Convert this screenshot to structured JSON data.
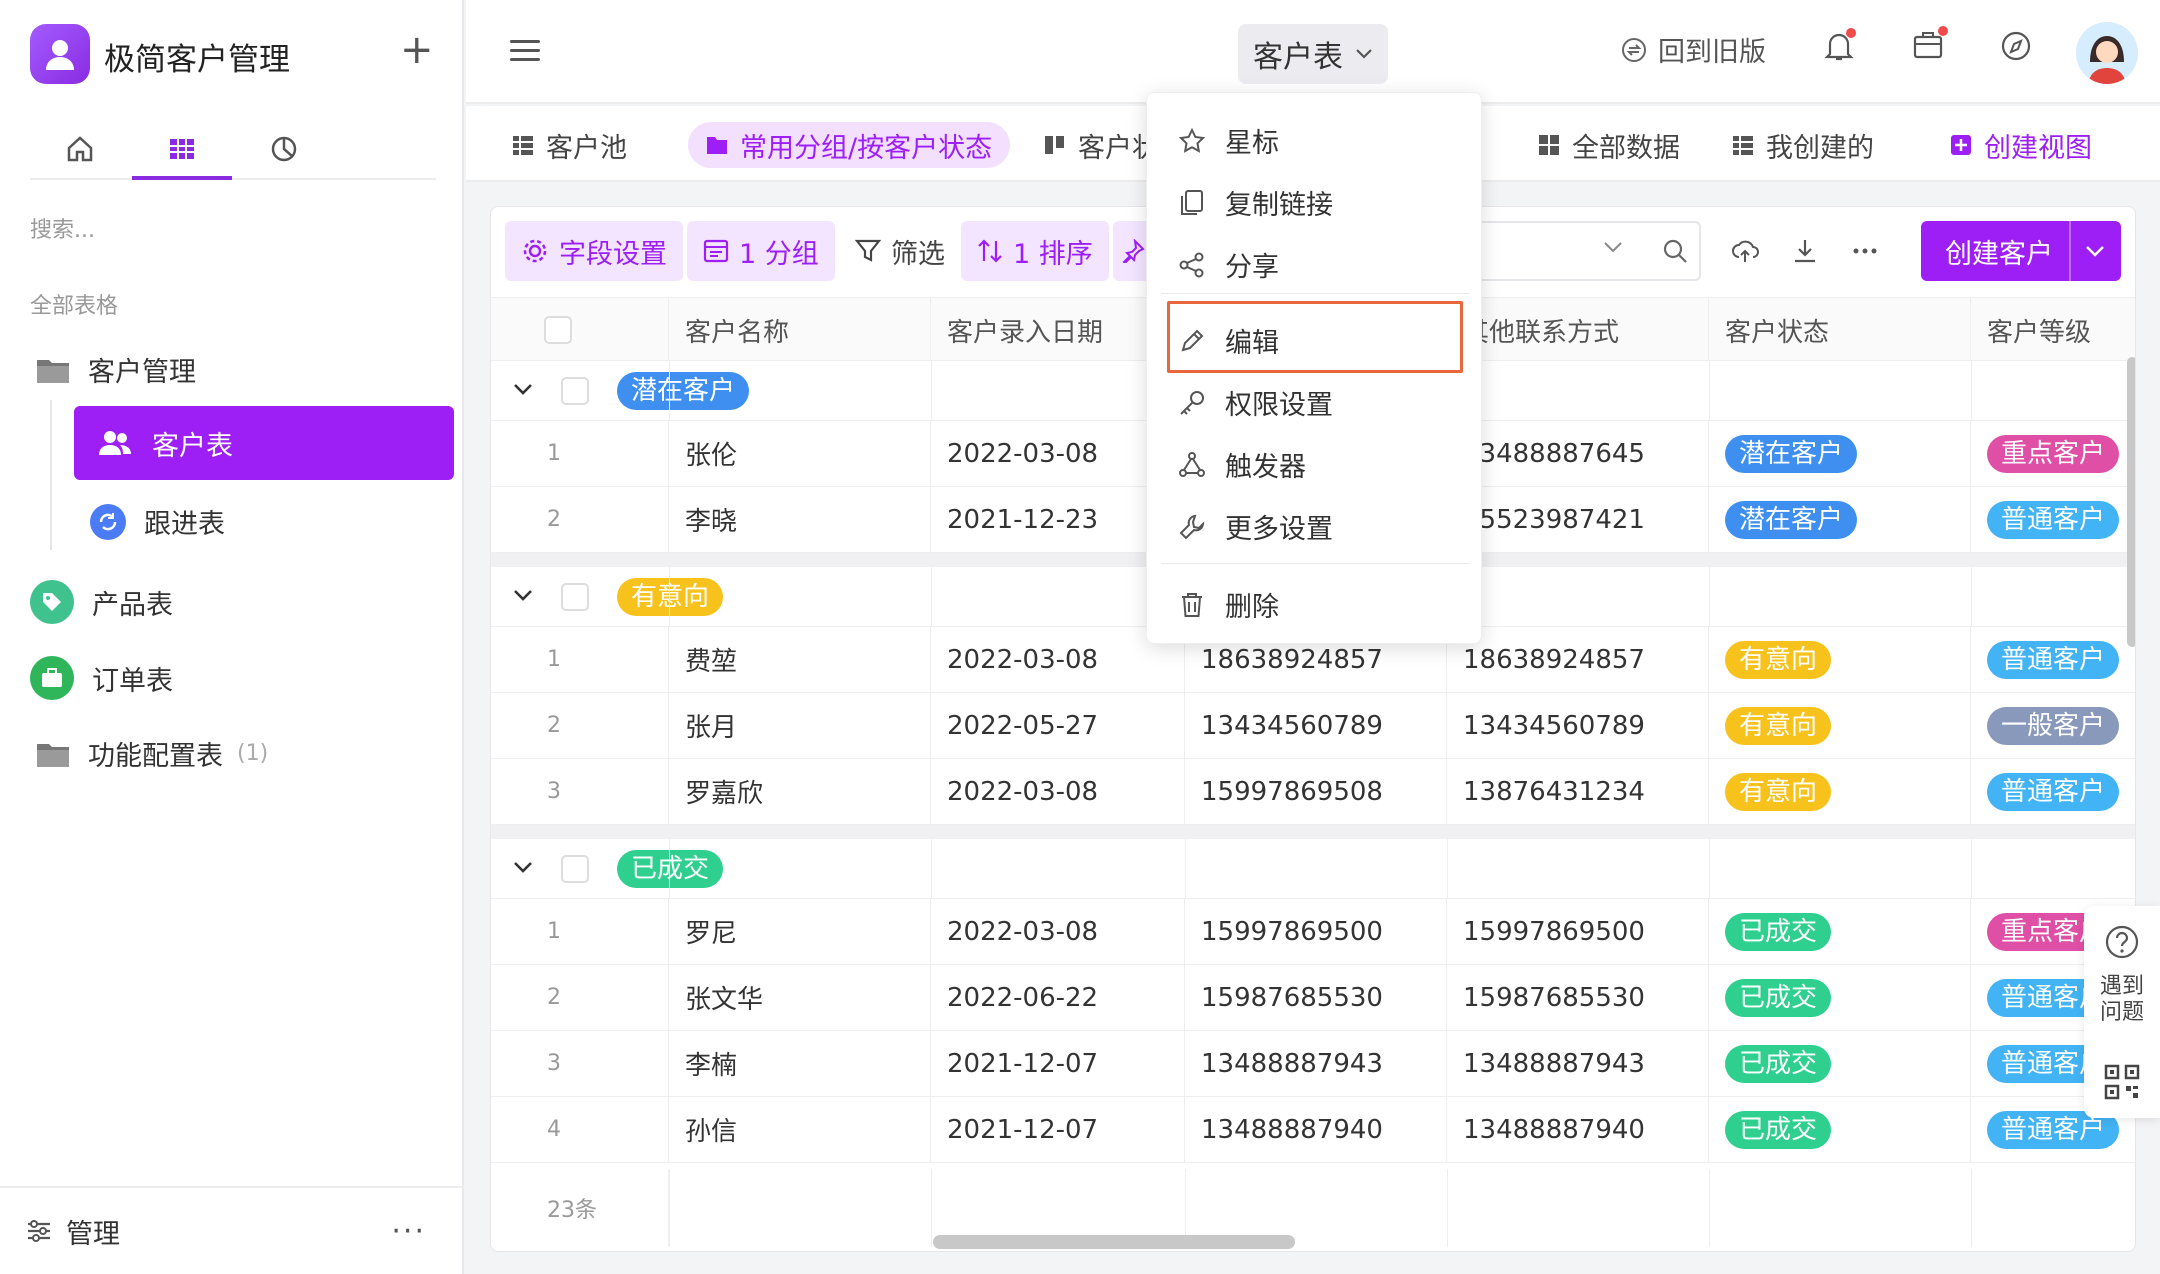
{
  "sidebar": {
    "app_title": "极简客户管理",
    "search_placeholder": "搜索...",
    "section_label": "全部表格",
    "items": [
      {
        "label": "客户管理"
      },
      {
        "label": "客户表"
      },
      {
        "label": "跟进表"
      },
      {
        "label": "产品表"
      },
      {
        "label": "订单表"
      },
      {
        "label": "功能配置表",
        "count": "(1)"
      }
    ],
    "footer_label": "管理",
    "footer_more": "···"
  },
  "header": {
    "title": "客户表",
    "back_old": "回到旧版"
  },
  "views": {
    "items": [
      {
        "label": "客户池"
      },
      {
        "label": "常用分组/按客户状态"
      },
      {
        "label": "客户状"
      },
      {
        "label": "全部数据"
      },
      {
        "label": "我创建的"
      },
      {
        "label": "创建视图"
      }
    ]
  },
  "toolbar": {
    "field_settings": "字段设置",
    "group": "1 分组",
    "filter": "筛选",
    "sort": "1 排序",
    "create_customer": "创建客户"
  },
  "table": {
    "headers": [
      "客户名称",
      "客户录入日期",
      "",
      "其他联系方式",
      "客户状态",
      "客户等级"
    ],
    "groups": [
      {
        "name": "潜在客户",
        "rows": [
          {
            "n": "1",
            "name": "张伦",
            "date": "2022-03-08",
            "phone": "",
            "other": "13488887645",
            "status": "潜在客户",
            "level": "重点客户"
          },
          {
            "n": "2",
            "name": "李晓",
            "date": "2021-12-23",
            "phone": "",
            "other": "15523987421",
            "status": "潜在客户",
            "level": "普通客户"
          }
        ]
      },
      {
        "name": "有意向",
        "rows": [
          {
            "n": "1",
            "name": "费堃",
            "date": "2022-03-08",
            "phone": "18638924857",
            "other": "18638924857",
            "status": "有意向",
            "level": "普通客户"
          },
          {
            "n": "2",
            "name": "张月",
            "date": "2022-05-27",
            "phone": "13434560789",
            "other": "13434560789",
            "status": "有意向",
            "level": "一般客户"
          },
          {
            "n": "3",
            "name": "罗嘉欣",
            "date": "2022-03-08",
            "phone": "15997869508",
            "other": "13876431234",
            "status": "有意向",
            "level": "普通客户"
          }
        ]
      },
      {
        "name": "已成交",
        "rows": [
          {
            "n": "1",
            "name": "罗尼",
            "date": "2022-03-08",
            "phone": "15997869500",
            "other": "15997869500",
            "status": "已成交",
            "level": "重点客户"
          },
          {
            "n": "2",
            "name": "张文华",
            "date": "2022-06-22",
            "phone": "15987685530",
            "other": "15987685530",
            "status": "已成交",
            "level": "普通客户"
          },
          {
            "n": "3",
            "name": "李楠",
            "date": "2021-12-07",
            "phone": "13488887943",
            "other": "13488887943",
            "status": "已成交",
            "level": "普通客户"
          },
          {
            "n": "4",
            "name": "孙信",
            "date": "2021-12-07",
            "phone": "13488887940",
            "other": "13488887940",
            "status": "已成交",
            "level": "普通客户"
          }
        ]
      }
    ],
    "total": "23条"
  },
  "dropdown": {
    "items": [
      {
        "label": "星标"
      },
      {
        "label": "复制链接"
      },
      {
        "label": "分享"
      },
      {
        "label": "编辑"
      },
      {
        "label": "权限设置"
      },
      {
        "label": "触发器"
      },
      {
        "label": "更多设置"
      },
      {
        "label": "删除"
      }
    ]
  },
  "help": {
    "label": "遇到问题"
  },
  "colors": {
    "accent": "#9d1ff5",
    "status_potential": "#3f8ff0",
    "status_intent": "#f8c21c",
    "status_deal": "#2fd08f",
    "level_key": "#e04fa6",
    "level_normal": "#42b3f4",
    "level_general": "#8899bb"
  }
}
